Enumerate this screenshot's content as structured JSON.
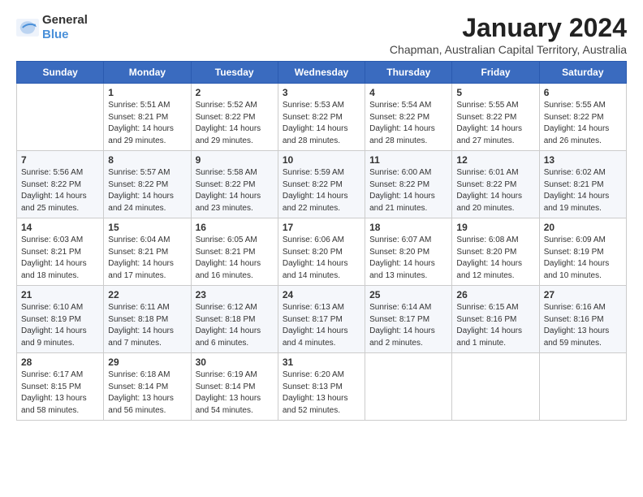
{
  "header": {
    "logo": {
      "general": "General",
      "blue": "Blue"
    },
    "title": "January 2024",
    "subtitle": "Chapman, Australian Capital Territory, Australia"
  },
  "weekdays": [
    "Sunday",
    "Monday",
    "Tuesday",
    "Wednesday",
    "Thursday",
    "Friday",
    "Saturday"
  ],
  "weeks": [
    [
      {
        "day": "",
        "content": ""
      },
      {
        "day": "1",
        "content": "Sunrise: 5:51 AM\nSunset: 8:21 PM\nDaylight: 14 hours\nand 29 minutes."
      },
      {
        "day": "2",
        "content": "Sunrise: 5:52 AM\nSunset: 8:22 PM\nDaylight: 14 hours\nand 29 minutes."
      },
      {
        "day": "3",
        "content": "Sunrise: 5:53 AM\nSunset: 8:22 PM\nDaylight: 14 hours\nand 28 minutes."
      },
      {
        "day": "4",
        "content": "Sunrise: 5:54 AM\nSunset: 8:22 PM\nDaylight: 14 hours\nand 28 minutes."
      },
      {
        "day": "5",
        "content": "Sunrise: 5:55 AM\nSunset: 8:22 PM\nDaylight: 14 hours\nand 27 minutes."
      },
      {
        "day": "6",
        "content": "Sunrise: 5:55 AM\nSunset: 8:22 PM\nDaylight: 14 hours\nand 26 minutes."
      }
    ],
    [
      {
        "day": "7",
        "content": "Sunrise: 5:56 AM\nSunset: 8:22 PM\nDaylight: 14 hours\nand 25 minutes."
      },
      {
        "day": "8",
        "content": "Sunrise: 5:57 AM\nSunset: 8:22 PM\nDaylight: 14 hours\nand 24 minutes."
      },
      {
        "day": "9",
        "content": "Sunrise: 5:58 AM\nSunset: 8:22 PM\nDaylight: 14 hours\nand 23 minutes."
      },
      {
        "day": "10",
        "content": "Sunrise: 5:59 AM\nSunset: 8:22 PM\nDaylight: 14 hours\nand 22 minutes."
      },
      {
        "day": "11",
        "content": "Sunrise: 6:00 AM\nSunset: 8:22 PM\nDaylight: 14 hours\nand 21 minutes."
      },
      {
        "day": "12",
        "content": "Sunrise: 6:01 AM\nSunset: 8:22 PM\nDaylight: 14 hours\nand 20 minutes."
      },
      {
        "day": "13",
        "content": "Sunrise: 6:02 AM\nSunset: 8:21 PM\nDaylight: 14 hours\nand 19 minutes."
      }
    ],
    [
      {
        "day": "14",
        "content": "Sunrise: 6:03 AM\nSunset: 8:21 PM\nDaylight: 14 hours\nand 18 minutes."
      },
      {
        "day": "15",
        "content": "Sunrise: 6:04 AM\nSunset: 8:21 PM\nDaylight: 14 hours\nand 17 minutes."
      },
      {
        "day": "16",
        "content": "Sunrise: 6:05 AM\nSunset: 8:21 PM\nDaylight: 14 hours\nand 16 minutes."
      },
      {
        "day": "17",
        "content": "Sunrise: 6:06 AM\nSunset: 8:20 PM\nDaylight: 14 hours\nand 14 minutes."
      },
      {
        "day": "18",
        "content": "Sunrise: 6:07 AM\nSunset: 8:20 PM\nDaylight: 14 hours\nand 13 minutes."
      },
      {
        "day": "19",
        "content": "Sunrise: 6:08 AM\nSunset: 8:20 PM\nDaylight: 14 hours\nand 12 minutes."
      },
      {
        "day": "20",
        "content": "Sunrise: 6:09 AM\nSunset: 8:19 PM\nDaylight: 14 hours\nand 10 minutes."
      }
    ],
    [
      {
        "day": "21",
        "content": "Sunrise: 6:10 AM\nSunset: 8:19 PM\nDaylight: 14 hours\nand 9 minutes."
      },
      {
        "day": "22",
        "content": "Sunrise: 6:11 AM\nSunset: 8:18 PM\nDaylight: 14 hours\nand 7 minutes."
      },
      {
        "day": "23",
        "content": "Sunrise: 6:12 AM\nSunset: 8:18 PM\nDaylight: 14 hours\nand 6 minutes."
      },
      {
        "day": "24",
        "content": "Sunrise: 6:13 AM\nSunset: 8:17 PM\nDaylight: 14 hours\nand 4 minutes."
      },
      {
        "day": "25",
        "content": "Sunrise: 6:14 AM\nSunset: 8:17 PM\nDaylight: 14 hours\nand 2 minutes."
      },
      {
        "day": "26",
        "content": "Sunrise: 6:15 AM\nSunset: 8:16 PM\nDaylight: 14 hours\nand 1 minute."
      },
      {
        "day": "27",
        "content": "Sunrise: 6:16 AM\nSunset: 8:16 PM\nDaylight: 13 hours\nand 59 minutes."
      }
    ],
    [
      {
        "day": "28",
        "content": "Sunrise: 6:17 AM\nSunset: 8:15 PM\nDaylight: 13 hours\nand 58 minutes."
      },
      {
        "day": "29",
        "content": "Sunrise: 6:18 AM\nSunset: 8:14 PM\nDaylight: 13 hours\nand 56 minutes."
      },
      {
        "day": "30",
        "content": "Sunrise: 6:19 AM\nSunset: 8:14 PM\nDaylight: 13 hours\nand 54 minutes."
      },
      {
        "day": "31",
        "content": "Sunrise: 6:20 AM\nSunset: 8:13 PM\nDaylight: 13 hours\nand 52 minutes."
      },
      {
        "day": "",
        "content": ""
      },
      {
        "day": "",
        "content": ""
      },
      {
        "day": "",
        "content": ""
      }
    ]
  ]
}
